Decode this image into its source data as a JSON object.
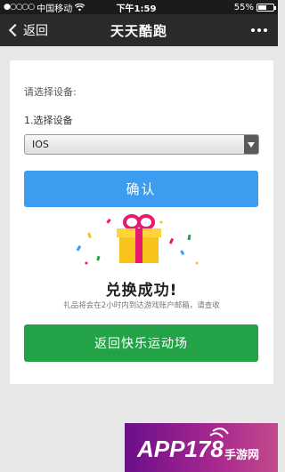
{
  "status_bar": {
    "signal_dots": "●○○○○",
    "carrier": "中国移动",
    "wifi_icon": "wifi-icon",
    "time": "下午1:59",
    "battery_percent": "55%",
    "battery_level": 0.55
  },
  "nav": {
    "back_label": "返回",
    "title": "天天酷跑",
    "more_icon": "more-dots-icon"
  },
  "form": {
    "prompt": "请选择设备:",
    "step_label": "1.选择设备",
    "device_selected": "IOS",
    "confirm_label": "确认"
  },
  "result": {
    "title": "兑换成功!",
    "note": "礼品将会在2小时内到达游戏账户邮箱，请查收",
    "return_label": "返回快乐运动场"
  },
  "watermark": {
    "text": "APP178手游网"
  },
  "colors": {
    "confirm_button": "#3c9df0",
    "return_button": "#23a347",
    "gift_box": "#f7c31b",
    "gift_ribbon": "#e8196e",
    "nav_background": "#2a2a2a"
  }
}
